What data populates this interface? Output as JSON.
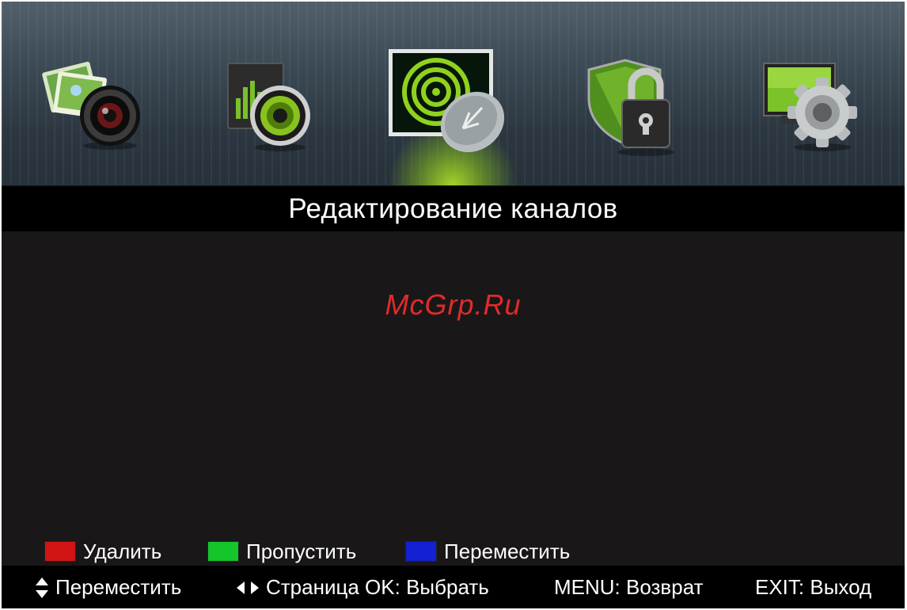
{
  "menu": {
    "items": [
      {
        "name": "media-photo",
        "icon": "photo-camera-icon"
      },
      {
        "name": "music",
        "icon": "music-speaker-icon"
      },
      {
        "name": "channel-edit",
        "icon": "satellite-dish-icon",
        "selected": true
      },
      {
        "name": "security",
        "icon": "shield-lock-icon"
      },
      {
        "name": "settings",
        "icon": "monitor-gear-icon"
      }
    ],
    "highlight_color": "#a8d82a"
  },
  "title": "Редактирование каналов",
  "watermark": "McGrp.Ru",
  "legend": {
    "delete": {
      "label": "Удалить",
      "color": "#d11414"
    },
    "skip": {
      "label": "Пропустить",
      "color": "#14c62a"
    },
    "move": {
      "label": "Переместить",
      "color": "#1420d4"
    }
  },
  "help": {
    "move": "Переместить",
    "page_ok": "Страница OK: Выбрать",
    "menu": "MENU: Возврат",
    "exit": "EXIT: Выход"
  }
}
